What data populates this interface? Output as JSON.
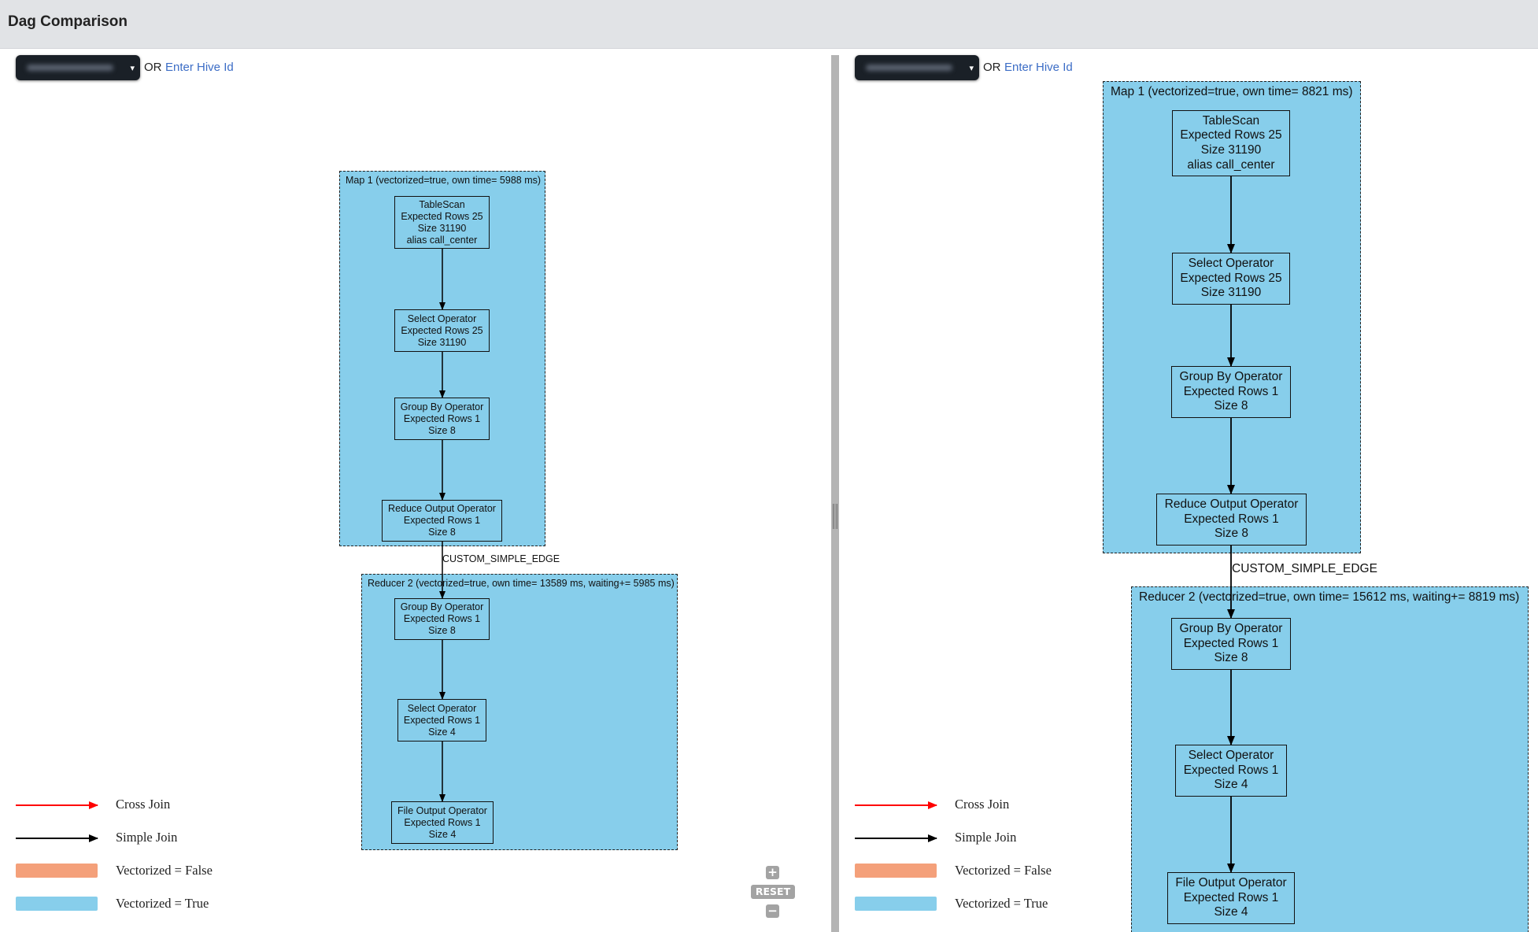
{
  "header": {
    "title": "Dag Comparison"
  },
  "colors": {
    "vertex_true": "#87ceeb",
    "vertex_false": "#f4a07a",
    "cross_join": "#ff0000",
    "simple_join": "#000000",
    "link": "#3c6dc6",
    "header_bg": "#e1e3e6"
  },
  "left": {
    "selector_caret": "▾",
    "or_label": "OR",
    "hive_link": "Enter Hive Id",
    "map_title": "Map 1 (vectorized=true, own time= 5988 ms)",
    "reducer_title": "Reducer 2 (vectorized=true, own time= 13589 ms, waiting+= 5985 ms)",
    "edge_label": "CUSTOM_SIMPLE_EDGE",
    "ops": [
      [
        "TableScan",
        "Expected Rows 25",
        "Size 31190",
        "alias call_center"
      ],
      [
        "Select Operator",
        "Expected Rows 25",
        "Size 31190"
      ],
      [
        "Group By Operator",
        "Expected Rows 1",
        "Size 8"
      ],
      [
        "Reduce Output Operator",
        "Expected Rows 1",
        "Size 8"
      ],
      [
        "Group By Operator",
        "Expected Rows 1",
        "Size 8"
      ],
      [
        "Select Operator",
        "Expected Rows 1",
        "Size 4"
      ],
      [
        "File Output Operator",
        "Expected Rows 1",
        "Size 4"
      ]
    ],
    "zoom": {
      "plus": "+",
      "reset": "RESET",
      "minus": "−"
    }
  },
  "right": {
    "selector_caret": "▾",
    "or_label": "OR",
    "hive_link": "Enter Hive Id",
    "map_title": "Map 1 (vectorized=true, own time= 8821 ms)",
    "reducer_title": "Reducer 2 (vectorized=true, own time= 15612 ms, waiting+= 8819 ms)",
    "edge_label": "CUSTOM_SIMPLE_EDGE",
    "ops": [
      [
        "TableScan",
        "Expected Rows 25",
        "Size 31190",
        "alias call_center"
      ],
      [
        "Select Operator",
        "Expected Rows 25",
        "Size 31190"
      ],
      [
        "Group By Operator",
        "Expected Rows 1",
        "Size 8"
      ],
      [
        "Reduce Output Operator",
        "Expected Rows 1",
        "Size 8"
      ],
      [
        "Group By Operator",
        "Expected Rows 1",
        "Size 8"
      ],
      [
        "Select Operator",
        "Expected Rows 1",
        "Size 4"
      ],
      [
        "File Output Operator",
        "Expected Rows 1",
        "Size 4"
      ]
    ]
  },
  "legend": {
    "cross_join": "Cross Join",
    "simple_join": "Simple Join",
    "vectorized_false": "Vectorized = False",
    "vectorized_true": "Vectorized = True"
  }
}
